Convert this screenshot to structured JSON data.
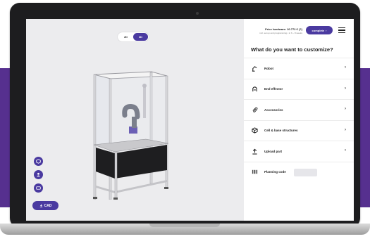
{
  "viewer": {
    "toggle": {
      "option_2d": "2D",
      "option_3d": "3D",
      "selected": "3D"
    },
    "side_tools": [
      {
        "icon": "cube-icon"
      },
      {
        "icon": "person-icon"
      },
      {
        "icon": "card-icon"
      }
    ],
    "cad_button": {
      "label": "CAD",
      "icon": "download-icon"
    }
  },
  "panel": {
    "price": "Price hardware: 10.772 € (?)",
    "price_sub": "incl. set up and programming • in 6 – 8 weeks",
    "complete_button": "complete",
    "title": "What do you want to customize?",
    "options": [
      {
        "label": "Robot",
        "icon": "robot-arm-icon"
      },
      {
        "label": "End effector",
        "icon": "gripper-icon"
      },
      {
        "label": "Accessories",
        "icon": "paperclip-icon"
      },
      {
        "label": "Cell & base structures",
        "icon": "box-icon"
      },
      {
        "label": "Upload part",
        "icon": "upload-icon"
      }
    ],
    "planning_code": {
      "label": "Planning code",
      "icon": "barcode-icon",
      "value": ""
    }
  },
  "colors": {
    "brand": "#4a3aa0",
    "band": "#56308f"
  }
}
